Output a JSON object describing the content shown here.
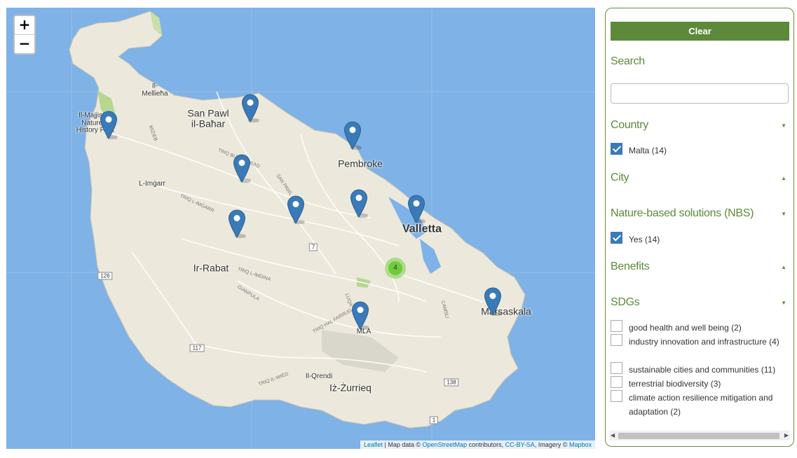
{
  "map": {
    "zoom_in": "+",
    "zoom_out": "−",
    "places": [
      {
        "name": "Il-\nMellieħa",
        "cls": "sm"
      },
      {
        "name": "Il-Majjistral\nNature &\nHistory Park",
        "cls": "sm"
      },
      {
        "name": "San Pawl\nil-Baħar",
        "cls": "big"
      },
      {
        "name": "Pembroke",
        "cls": "big"
      },
      {
        "name": "L-Imġarr",
        "cls": "sm"
      },
      {
        "name": "Valletta",
        "cls": "cap"
      },
      {
        "name": "Ir-Rabat",
        "cls": "big"
      },
      {
        "name": "Marsaskala",
        "cls": "big"
      },
      {
        "name": "MLA",
        "cls": "sm"
      },
      {
        "name": "Il-Qrendi",
        "cls": "sm"
      },
      {
        "name": "Iż-Żurrieq",
        "cls": "big"
      }
    ],
    "roads": [
      "TRIQ BURMARRAD",
      "SAN PAWL",
      "TRIQ L-IMGARR",
      "TRIQ L-IMDINA",
      "GIANPULA",
      "LUQA",
      "TRIQ HAL FARRUG",
      "TRIQ IL-WIED",
      "CAMSLI",
      "MIZIEB"
    ],
    "shields": [
      "7",
      "126",
      "117",
      "138",
      "1"
    ],
    "cluster_count": "4",
    "marker_count": 10,
    "attribution": {
      "leaflet": "Leaflet",
      "sep1": " | Map data © ",
      "osm": "OpenStreetMap",
      "sep2": " contributors, ",
      "license": "CC-BY-SA",
      "sep3": ", Imagery © ",
      "mapbox": "Mapbox"
    },
    "colors": {
      "water": "#7fb2e6",
      "land": "#ece9dc",
      "marker": "#3a7ab8",
      "cluster": "#6ecc39"
    }
  },
  "panel": {
    "clear_label": "Clear",
    "search_title": "Search",
    "search_value": "",
    "country_title": "Country",
    "country_options": [
      {
        "label": "Malta (14)",
        "checked": true
      }
    ],
    "city_title": "City",
    "nbs_title": "Nature-based solutions (NBS)",
    "nbs_options": [
      {
        "label": "Yes (14)",
        "checked": true
      }
    ],
    "benefits_title": "Benefits",
    "sdgs_title": "SDGs",
    "sdg_options": [
      {
        "label": "good health and well being (2)",
        "checked": false
      },
      {
        "label": "industry innovation and infrastructure (4)",
        "checked": false
      },
      {
        "label": "sustainable cities and communities (11)",
        "checked": false
      },
      {
        "label": "terrestrial biodiversity (3)",
        "checked": false
      },
      {
        "label": "climate action resilience mitigation and adaptation (2)",
        "checked": false
      }
    ],
    "arrow_down": "▼",
    "arrow_up": "▲",
    "accent": "#5d8a3a"
  }
}
